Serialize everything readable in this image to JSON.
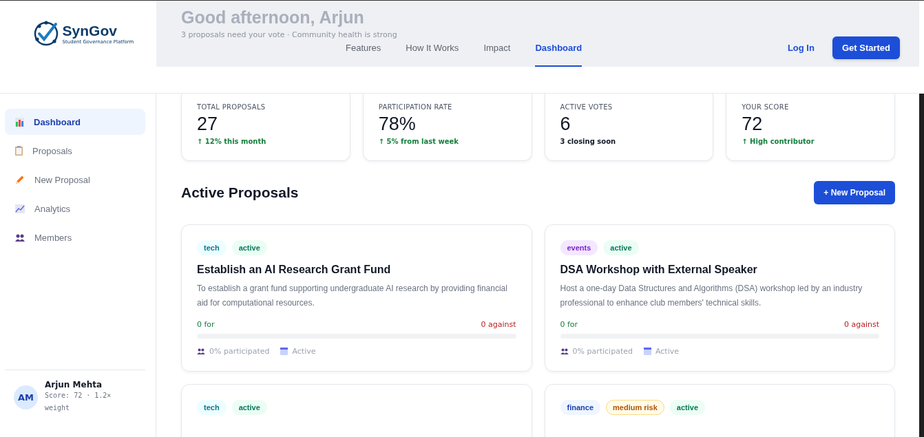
{
  "brand": {
    "name": "SynGov",
    "tagline": "Student Governance Platform"
  },
  "banner": {
    "greeting": "Good afternoon, Arjun",
    "subtitle": "3 proposals need your vote · Community health is strong"
  },
  "nav": [
    {
      "label": "Features",
      "selected": false
    },
    {
      "label": "How It Works",
      "selected": false
    },
    {
      "label": "Impact",
      "selected": false
    },
    {
      "label": "Dashboard",
      "selected": true
    }
  ],
  "login": "Log In",
  "cta": "Get Started",
  "sidebar": {
    "items": [
      {
        "label": "Dashboard",
        "selected": true
      },
      {
        "label": "Proposals",
        "selected": false
      },
      {
        "label": "New Proposal",
        "selected": false
      },
      {
        "label": "Analytics",
        "selected": false
      },
      {
        "label": "Members",
        "selected": false
      }
    ],
    "user": {
      "initials": "AM",
      "name": "Arjun Mehta",
      "meta": "Score: 72 · 1.2× weight"
    }
  },
  "stats": [
    {
      "label": "TOTAL PROPOSALS",
      "value": "27",
      "note": "↑ 12% this month",
      "kind": "up"
    },
    {
      "label": "PARTICIPATION RATE",
      "value": "78%",
      "note": "↑ 5% from last week",
      "kind": "up"
    },
    {
      "label": "ACTIVE VOTES",
      "value": "6",
      "note": "3 closing soon",
      "kind": "neutral"
    },
    {
      "label": "YOUR SCORE",
      "value": "72",
      "note": "↑ High contributor",
      "kind": "up"
    }
  ],
  "section_title": "Active Proposals",
  "new_button": "+ New Proposal",
  "proposals": [
    {
      "tags": [
        {
          "label": "tech",
          "kind": "tech"
        },
        {
          "label": "active",
          "kind": "status"
        }
      ],
      "title": "Establish an AI Research Grant Fund",
      "description": "To establish a grant fund supporting undergraduate AI research by providing financial aid for computational resources.",
      "for": "0 for",
      "against": "0 against",
      "level": 0,
      "participation": "0% participated",
      "status": "Active"
    },
    {
      "tags": [
        {
          "label": "events",
          "kind": "events"
        },
        {
          "label": "active",
          "kind": "status"
        }
      ],
      "title": "DSA Workshop with External Speaker",
      "description": "Host a one-day Data Structures and Algorithms (DSA) workshop led by an industry professional to enhance club members' technical skills.",
      "for": "0 for",
      "against": "0 against",
      "level": 0,
      "participation": "0% participated",
      "status": "Active"
    },
    {
      "tags": [
        {
          "label": "tech",
          "kind": "tech"
        },
        {
          "label": "active",
          "kind": "status"
        }
      ]
    },
    {
      "tags": [
        {
          "label": "finance",
          "kind": "finance"
        },
        {
          "label": "medium risk",
          "kind": "risk"
        },
        {
          "label": "active",
          "kind": "status"
        }
      ]
    }
  ]
}
